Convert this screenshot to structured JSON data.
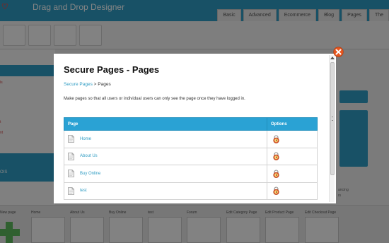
{
  "app": {
    "title": "Drag and Drop Designer",
    "logo_glyph": "♡",
    "tabs": [
      "Basic",
      "Advanced",
      "Ecommerce",
      "Blog",
      "Pages",
      "The"
    ]
  },
  "sidebar": {
    "fragments": [
      "ls",
      "t",
      "nt",
      "OIS"
    ]
  },
  "bottom_strip": {
    "labels": [
      "New page",
      "Home",
      "About Us",
      "Buy Online",
      "test",
      "Forum",
      "Edit Category Page",
      "Edit Product Page",
      "Edit Checkout Page"
    ]
  },
  "right_panel": {
    "fragments": [
      "ancing",
      "rs"
    ]
  },
  "modal": {
    "title": "Secure Pages - Pages",
    "breadcrumb": {
      "link": "Secure Pages",
      "separator": " > ",
      "current": "Pages"
    },
    "description": "Make pages so that all users or individual users can only see the page once they have logged in.",
    "table": {
      "columns": [
        "Page",
        "Options"
      ],
      "rows": [
        {
          "page": "Home",
          "option_icon": "lock-icon"
        },
        {
          "page": "About Us",
          "option_icon": "lock-icon"
        },
        {
          "page": "Buy Online",
          "option_icon": "lock-icon"
        },
        {
          "page": "test",
          "option_icon": "lock-icon"
        }
      ]
    }
  },
  "colors": {
    "accent": "#2aa2d4",
    "link": "#2f9cc3",
    "close": "#e8571f"
  }
}
